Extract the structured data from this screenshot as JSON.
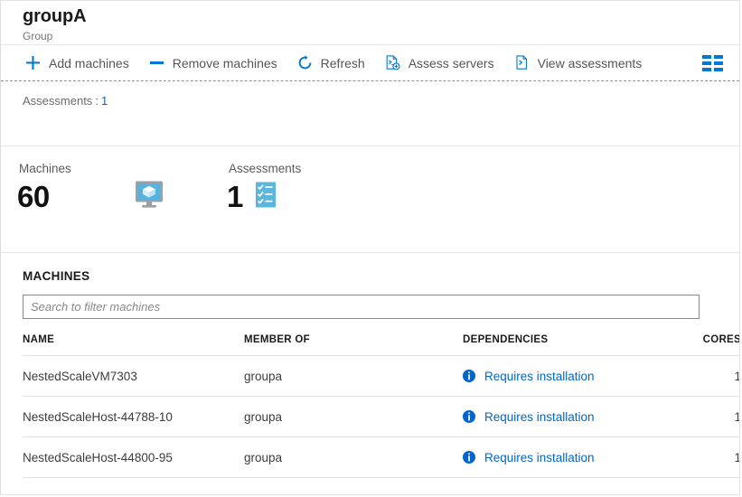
{
  "header": {
    "title": "groupA",
    "subtitle": "Group"
  },
  "commandbar": {
    "items": [
      {
        "label": "Add machines",
        "icon": "plus-icon"
      },
      {
        "label": "Remove machines",
        "icon": "minus-icon"
      },
      {
        "label": "Refresh",
        "icon": "refresh-icon"
      },
      {
        "label": "Assess servers",
        "icon": "assess-servers-icon"
      },
      {
        "label": "View assessments",
        "icon": "view-assessments-icon"
      }
    ],
    "grid_icon": "column-options-icon"
  },
  "essentials": {
    "assessments_label": "Assessments",
    "separator": ":",
    "assessments_count": "1"
  },
  "stats": [
    {
      "title": "Machines",
      "value": "60",
      "icon": "monitor-cube-icon"
    },
    {
      "title": "Assessments",
      "value": "1",
      "icon": "checklist-icon"
    }
  ],
  "machines_section": {
    "title": "MACHINES",
    "search_placeholder": "Search to filter machines",
    "search_value": "",
    "columns": [
      "NAME",
      "MEMBER OF",
      "DEPENDENCIES",
      "CORES"
    ],
    "rows": [
      {
        "name": "NestedScaleVM7303",
        "member_of": "groupa",
        "dependencies": "Requires installation",
        "dependencies_icon": "info-icon",
        "cores": "1"
      },
      {
        "name": "NestedScaleHost-44788-10",
        "member_of": "groupa",
        "dependencies": "Requires installation",
        "dependencies_icon": "info-icon",
        "cores": "1"
      },
      {
        "name": "NestedScaleHost-44800-95",
        "member_of": "groupa",
        "dependencies": "Requires installation",
        "dependencies_icon": "info-icon",
        "cores": "1"
      }
    ]
  },
  "colors": {
    "accent": "#0078d4",
    "link": "#0066cc",
    "dashed_border": "#2bb3e8",
    "icon_light_blue": "#60bde0"
  }
}
